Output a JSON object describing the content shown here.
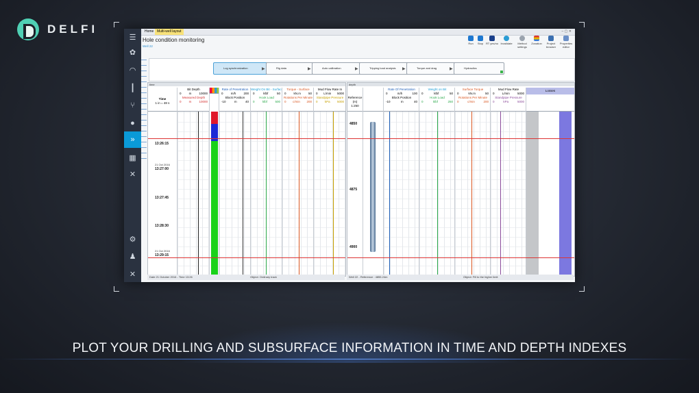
{
  "brand": {
    "name": "DELFI"
  },
  "caption": "PLOT YOUR DRILLING AND SUBSURFACE INFORMATION IN TIME AND DEPTH INDEXES",
  "window": {
    "tabs": [
      "Home",
      "Multi-well layout"
    ],
    "title": "Hole condition monitoring",
    "subtitle": "Well 22",
    "toolbar": [
      "Run",
      "Stop",
      "RT yes/no",
      "Invalidate",
      "Method settings",
      "Zonation",
      "Project browser",
      "Properties editor"
    ],
    "workflow": [
      "Log synchronization",
      "Rig data",
      "Auto calibration",
      "Tripping load analysis",
      "Torque and drag",
      "Hydraulics"
    ],
    "time_pane": {
      "header": "time",
      "index_label": "Time",
      "index_scale": "1 in = 48 s",
      "tracks": [
        {
          "top": "Bit Depth",
          "range": [
            "0",
            "m",
            "10000"
          ],
          "bottom": "Measured Depth",
          "brange": [
            "0",
            "m",
            "10000"
          ],
          "color": "#d32f2f"
        },
        {
          "top": "Rate of Penetration",
          "range": [
            "0",
            "m/h",
            "200"
          ],
          "bottom": "Block Position",
          "brange": [
            "-10",
            "m",
            "40"
          ],
          "color": "#1e5fb8"
        },
        {
          "top": "Weight On Bit - Surface",
          "range": [
            "0",
            "klbf",
            "50"
          ],
          "bottom": "Hook Load",
          "brange": [
            "0",
            "klbf",
            "500"
          ],
          "color": "#2aa84a"
        },
        {
          "top": "Torque - Surface",
          "range": [
            "0",
            "kN.m",
            "50"
          ],
          "bottom": "Rotations Per Minute",
          "brange": [
            "0",
            "c/min",
            "200"
          ],
          "color": "#d9541e"
        },
        {
          "top": "Mud Flow Rate In",
          "range": [
            "0",
            "L/min",
            "5000"
          ],
          "bottom": "Standpipe Pressure",
          "brange": [
            "0",
            "kPa",
            "5000"
          ],
          "color": "#c7a000"
        }
      ],
      "times": [
        {
          "date": "",
          "time": "13:26:15"
        },
        {
          "date": "21 Oct 2016",
          "time": "13:27:00"
        },
        {
          "date": "",
          "time": "13:27:45"
        },
        {
          "date": "",
          "time": "13:28:30"
        },
        {
          "date": "21 Oct 2016",
          "time": "13:29:15"
        }
      ],
      "status_left": "Date 21 October 2016 - Time 13:26",
      "status_right": "Object: Ordinary track"
    },
    "depth_pane": {
      "header": "depth",
      "index_label": "Reference (m)",
      "index_scale": "1:250",
      "tracks": [
        {
          "top": "Rate Of Penetration",
          "range": [
            "0",
            "m/h",
            "100"
          ],
          "bottom": "Block Position",
          "brange": [
            "-10",
            "m",
            "40"
          ],
          "color": "#1e5fb8"
        },
        {
          "top": "Weight on Bit",
          "range": [
            "0",
            "klbf",
            "50"
          ],
          "bottom": "Hook Load",
          "brange": [
            "0",
            "klbf",
            "250"
          ],
          "color": "#2aa84a"
        },
        {
          "top": "Surface Torque",
          "range": [
            "0",
            "kN.m",
            "50"
          ],
          "bottom": "Rotations Per Minute",
          "brange": [
            "0",
            "c/min",
            "200"
          ],
          "color": "#d9541e"
        },
        {
          "top": "Mud Flow Rate",
          "range": [
            "0",
            "L/min",
            "5000"
          ],
          "bottom": "Standpipe Pressure",
          "brange": [
            "0",
            "kPa",
            "5000"
          ],
          "color": "#8a4a9a"
        },
        {
          "top": "Losses",
          "range": [
            "",
            "",
            ""
          ],
          "bottom": "",
          "brange": [
            "",
            "",
            ""
          ],
          "color": "#6b6bd8"
        }
      ],
      "depths": [
        "4850",
        "4875",
        "4900"
      ],
      "status_left": "Well 22 - Reference : 4855.24m",
      "status_right": "Object: Fill to the higher limit"
    }
  },
  "colors": {
    "accent": "#0a9ad7",
    "nav": "#2a3240",
    "logo": "#4fd0b4"
  }
}
